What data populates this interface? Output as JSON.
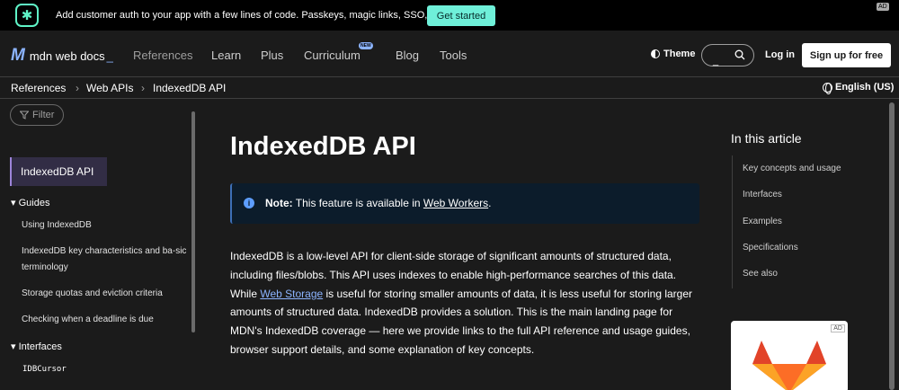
{
  "promo": {
    "text": "Add customer auth to your app with a few lines of code. Passkeys, magic links, SSO, and more.",
    "button": "Get started",
    "ad": "AD"
  },
  "nav": {
    "logo": "mdn web docs",
    "logo_cursor": "_",
    "items": [
      "References",
      "Learn",
      "Plus",
      "Curriculum",
      "Blog",
      "Tools"
    ],
    "new_badge": "NEW",
    "theme": "Theme",
    "search_cursor": "_",
    "login": "Log in",
    "signup": "Sign up for free"
  },
  "breadcrumb": [
    "References",
    "Web APIs",
    "IndexedDB API"
  ],
  "language": "English (US)",
  "sidebar": {
    "filter": "Filter",
    "active": "IndexedDB API",
    "guides_label": "Guides",
    "guides": [
      "Using IndexedDB",
      "IndexedDB key characteristics and ba-sic terminology",
      "Storage quotas and eviction criteria",
      "Checking when a deadline is due"
    ],
    "interfaces_label": "Interfaces",
    "interfaces": [
      "IDBCursor"
    ]
  },
  "article": {
    "title": "IndexedDB API",
    "note_label": "Note:",
    "note_text": "This feature is available in",
    "note_link": "Web Workers",
    "note_end": ".",
    "para_before": "IndexedDB is a low-level API for client-side storage of significant amounts of structured data, including files/blobs. This API uses indexes to enable high-performance searches of this data. While ",
    "para_link": "Web Storage",
    "para_after": " is useful for storing smaller amounts of data, it is less useful for storing larger amounts of structured data. IndexedDB provides a solution. This is the main landing page for MDN's IndexedDB coverage — here we provide links to the full API reference and usage guides, browser support details, and some explanation of key concepts."
  },
  "toc": {
    "title": "In this article",
    "items": [
      "Key concepts and usage",
      "Interfaces",
      "Examples",
      "Specifications",
      "See also"
    ]
  },
  "side_ad": {
    "label": "AD"
  },
  "colors": {
    "background": "#1b1b1b",
    "accent_link": "#8cb4ff",
    "promo_button": "#6ff0d9",
    "sidebar_active": "#322d45"
  }
}
